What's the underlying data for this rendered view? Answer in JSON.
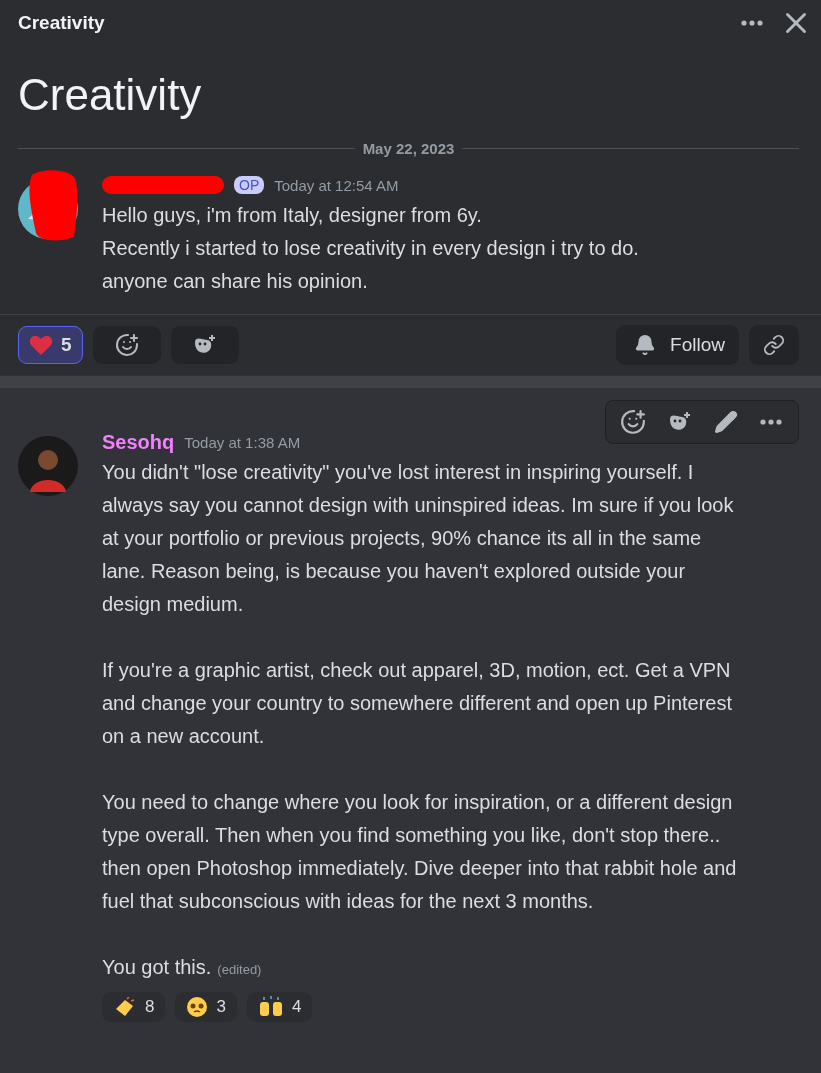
{
  "header": {
    "title": "Creativity"
  },
  "post_title": "Creativity",
  "date_divider": "May 22, 2023",
  "original_post": {
    "badge": "OP",
    "timestamp": "Today at 12:54 AM",
    "redacted": true,
    "lines": [
      "Hello guys, i'm from Italy, designer from 6y.",
      "Recently i started to lose creativity in every design i try to do.",
      "anyone can share his opinion."
    ],
    "reactions": [
      {
        "kind": "heart",
        "count": "5",
        "selected": true
      }
    ],
    "follow_label": "Follow"
  },
  "reply": {
    "author": "Sesohq",
    "timestamp": "Today at 1:38 AM",
    "paragraphs": [
      "You didn't \"lose creativity\" you've lost interest in inspiring yourself. I always say you cannot design with uninspired ideas. Im sure if you look at your portfolio or previous projects, 90% chance its all in the same lane. Reason being, is because you haven't explored outside your design medium.",
      "If you're a graphic artist, check out apparel, 3D, motion, ect. Get a VPN and change your country to somewhere different and open up Pinterest on a new account.",
      "You need to change where you look for inspiration, or a different design type overall. Then when you find something you like, don't stop there.. then open Photoshop immediately. Dive deeper into that rabbit hole and fuel that subconscious with ideas for the next 3 months.",
      "You got this."
    ],
    "edited": "(edited)",
    "reactions": [
      {
        "kind": "clap",
        "count": "8",
        "selected": false
      },
      {
        "kind": "pleading",
        "count": "3",
        "selected": false
      },
      {
        "kind": "raised-hands",
        "count": "4",
        "selected": false
      }
    ]
  }
}
